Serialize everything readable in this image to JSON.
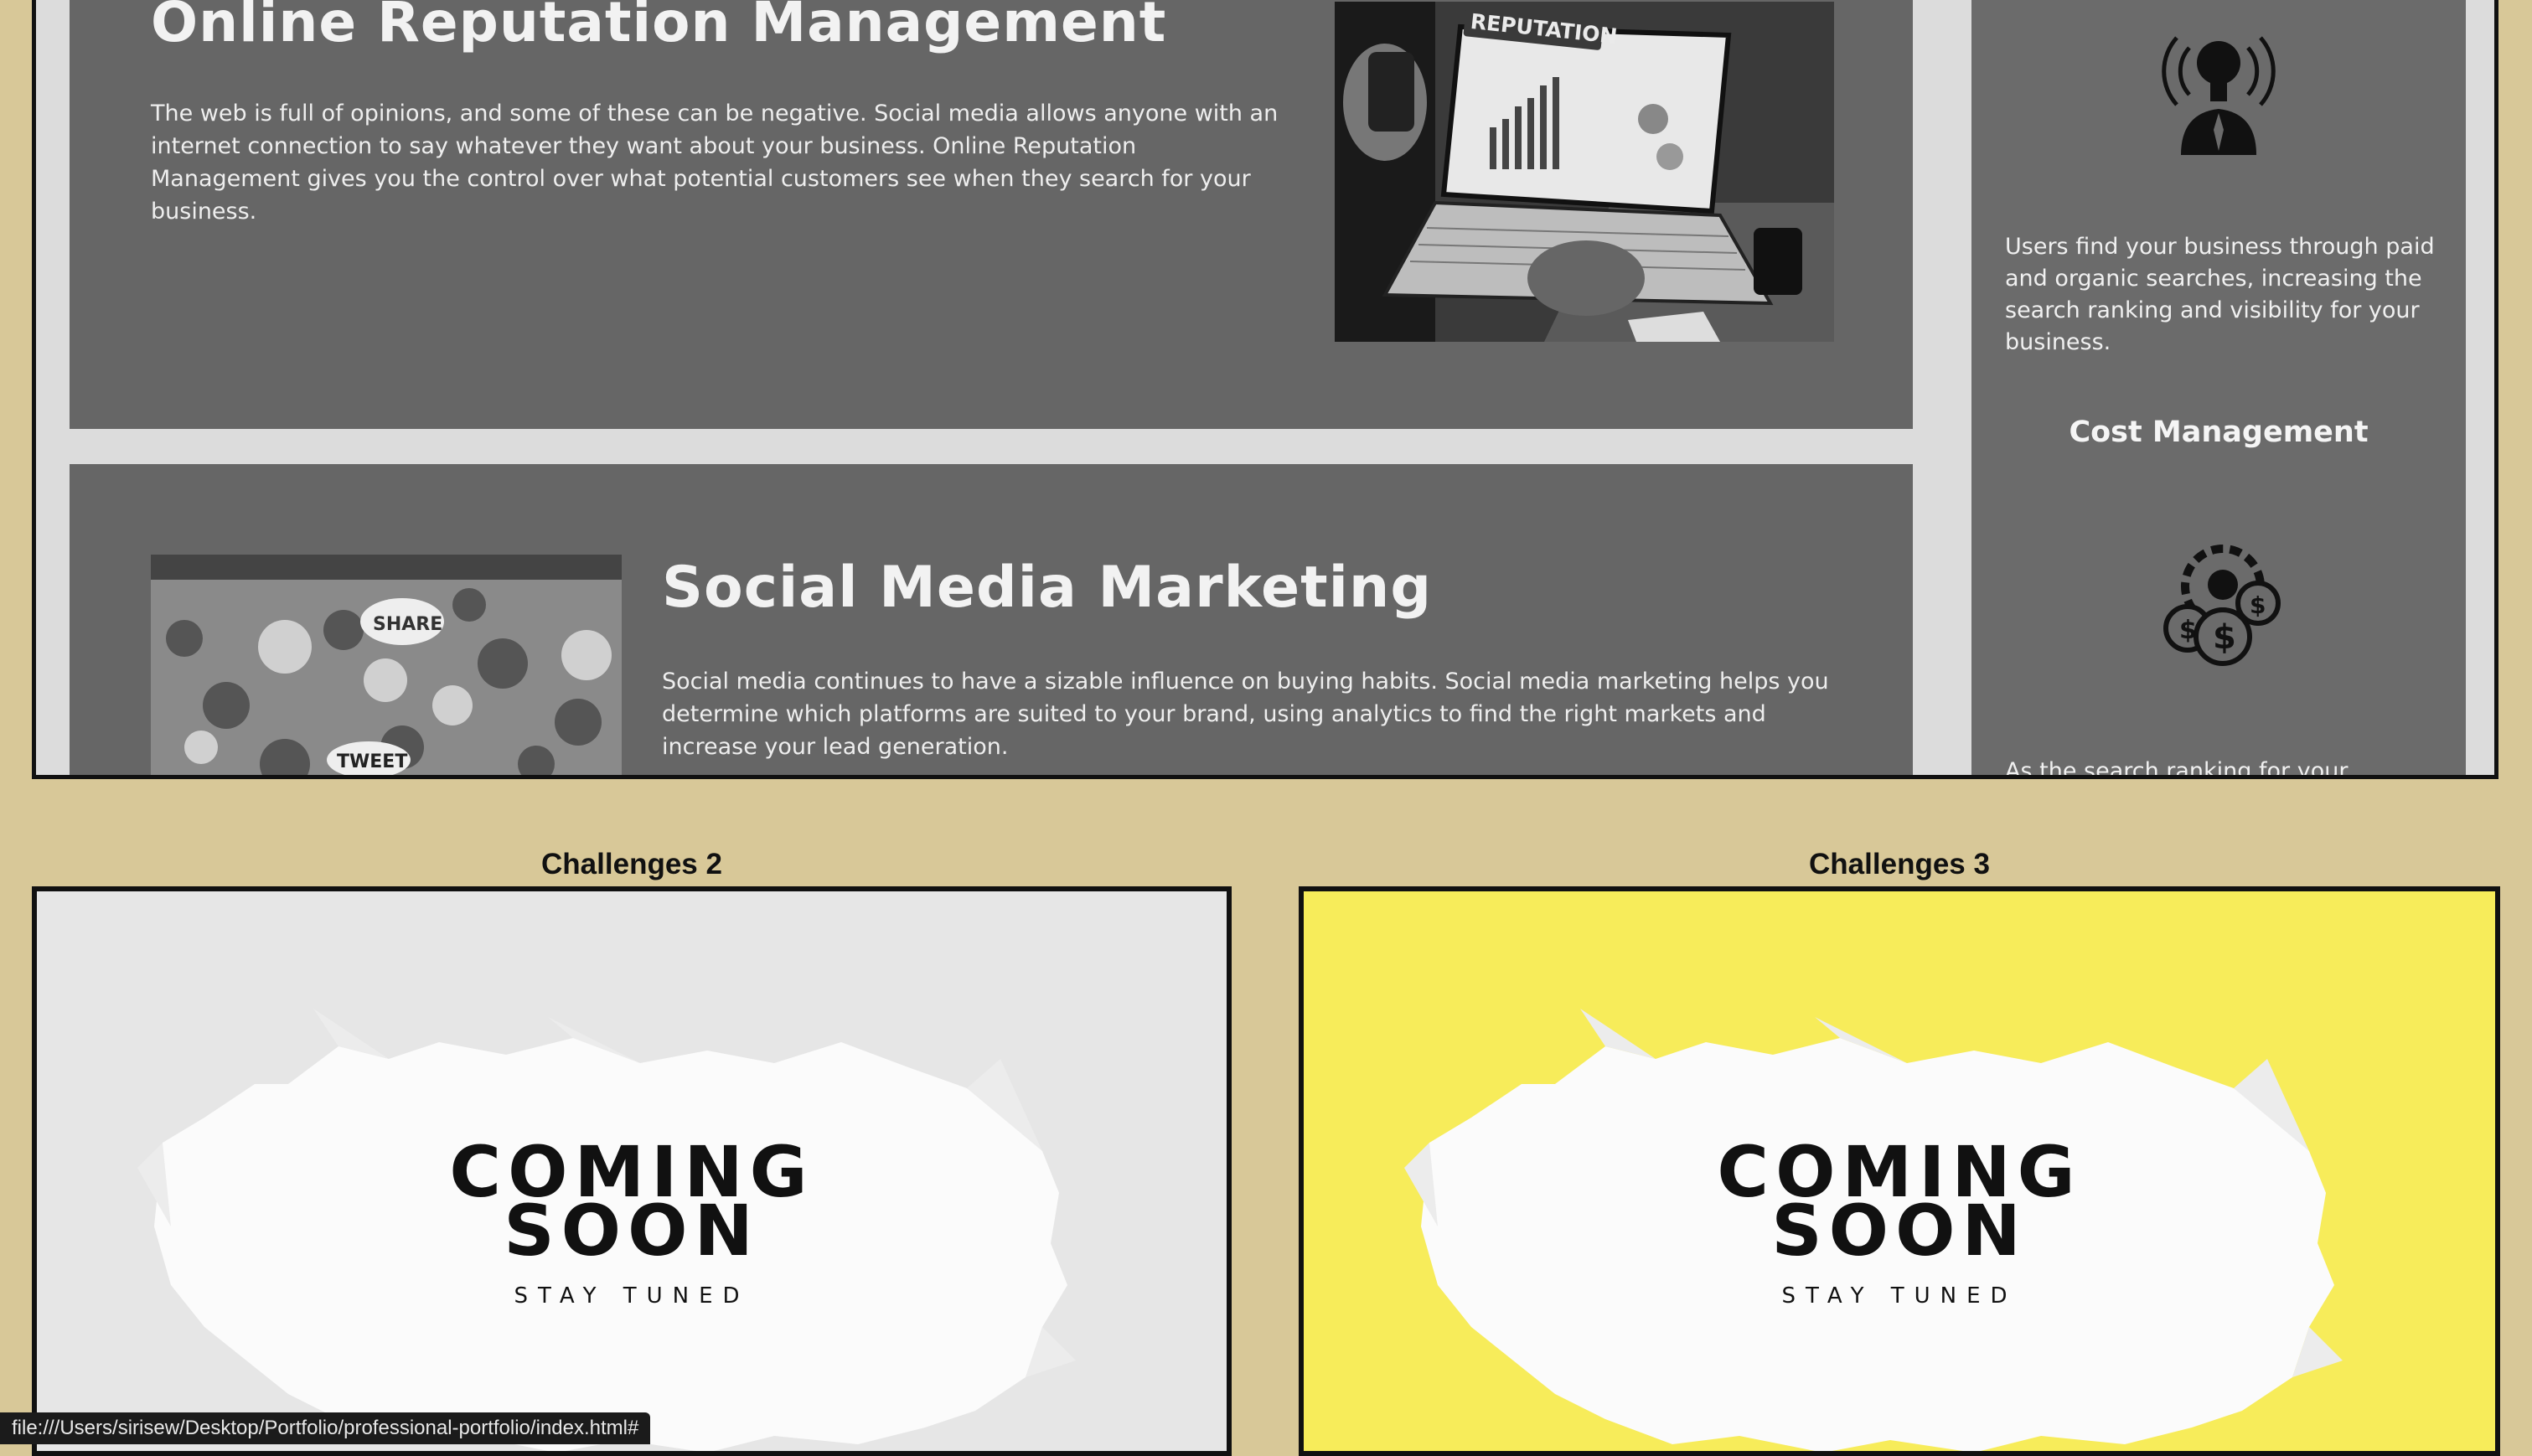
{
  "top_section": {
    "card1": {
      "title": "Online Reputation Management",
      "body": "The web is full of opinions, and some of these can be negative. Social media allows anyone with an internet connection to say whatever they want about your business. Online Reputation Management gives you the control over what potential customers see when they search for your business.",
      "image_text": "REPUTATION"
    },
    "card2": {
      "title": "Social Media Marketing",
      "body": "Social media continues to have a sizable influence on buying habits. Social media marketing helps you determine which platforms are suited to your brand, using analytics to find the right markets and increase your lead generation.",
      "image_texts": [
        "SHARE",
        "TWEET"
      ]
    },
    "sidebar": {
      "text1": "Users find your business through paid and organic searches, increasing the search ranking and visibility for your business.",
      "heading": "Cost Management",
      "text2": "As the search ranking for your business"
    }
  },
  "challenges": [
    {
      "title": "Challenges 2",
      "line1": "COMING",
      "line2": "SOON",
      "tagline": "STAY TUNED"
    },
    {
      "title": "Challenges 3",
      "line1": "COMING",
      "line2": "SOON",
      "tagline": "STAY TUNED"
    }
  ],
  "status_bar": {
    "url": "file:///Users/sirisew/Desktop/Portfolio/professional-portfolio/index.html#"
  },
  "colors": {
    "page_bg": "#d8c898",
    "card_bg": "#666666",
    "challenge3_bg": "#f7ec5a"
  }
}
